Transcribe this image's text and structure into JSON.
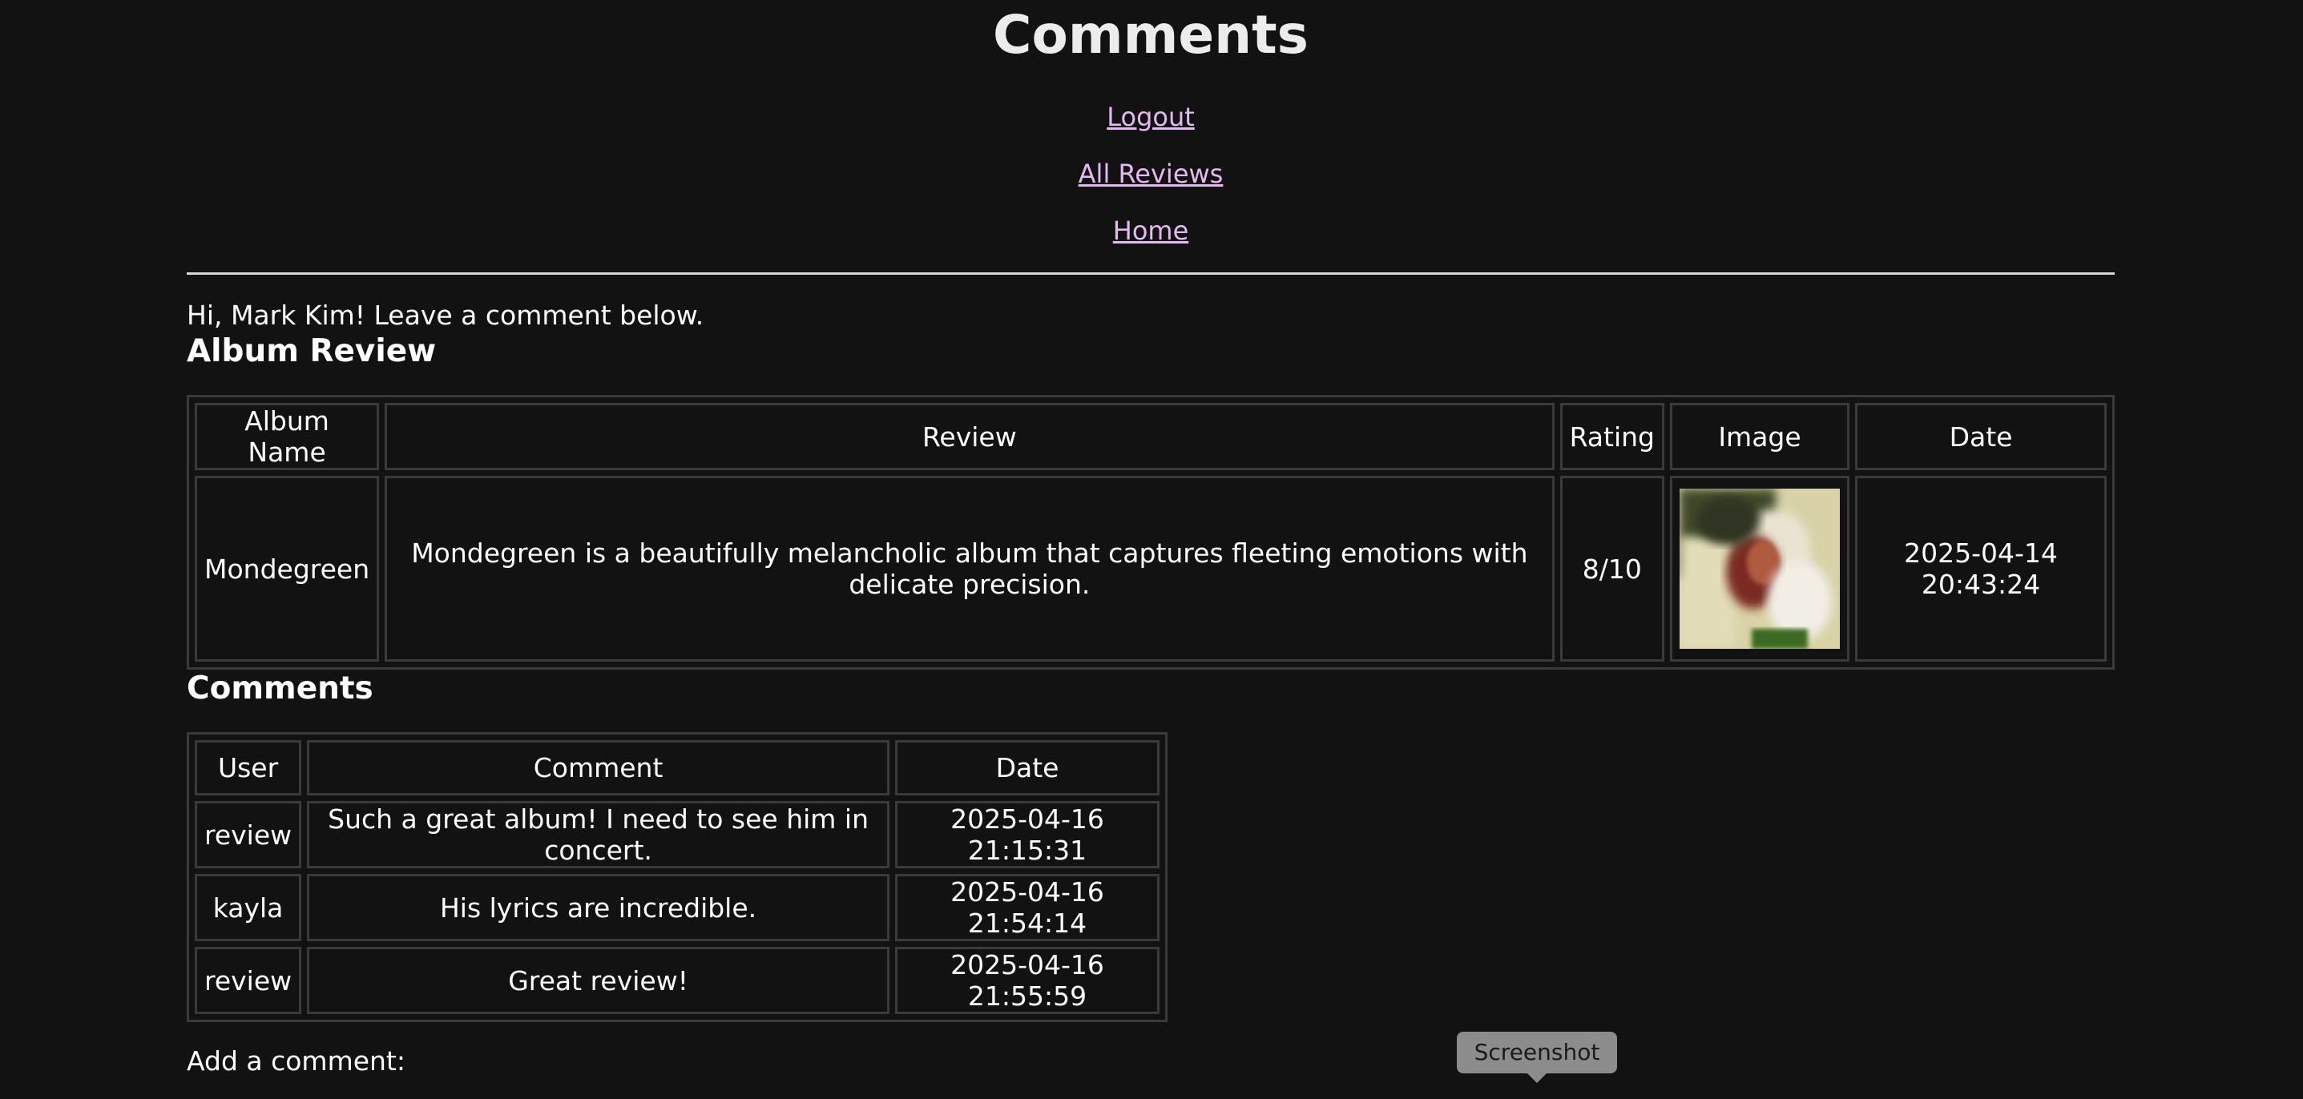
{
  "page": {
    "title": "Comments"
  },
  "nav": {
    "logout": "Logout",
    "all_reviews": "All Reviews",
    "home": "Home"
  },
  "greeting": "Hi, Mark Kim! Leave a comment below.",
  "album_review": {
    "heading": "Album Review",
    "columns": [
      "Album Name",
      "Review",
      "Rating",
      "Image",
      "Date"
    ],
    "row": {
      "album_name": "Mondegreen",
      "review": "Mondegreen is a beautifully melancholic album that captures fleeting emotions with delicate precision.",
      "rating": "8/10",
      "image": "album-cover-photo",
      "date": "2025-04-14 20:43:24"
    }
  },
  "comments": {
    "heading": "Comments",
    "columns": [
      "User",
      "Comment",
      "Date"
    ],
    "rows": [
      {
        "user": "review",
        "comment": "Such a great album! I need to see him in concert.",
        "date": "2025-04-16 21:15:31"
      },
      {
        "user": "kayla",
        "comment": "His lyrics are incredible.",
        "date": "2025-04-16 21:54:14"
      },
      {
        "user": "review",
        "comment": "Great review!",
        "date": "2025-04-16 21:55:59"
      }
    ]
  },
  "add_comment_label": "Add a comment:",
  "tooltip": "Screenshot",
  "colors": {
    "background": "#121212",
    "link": "#e4b8f0",
    "table_border": "#3a3a3a"
  }
}
